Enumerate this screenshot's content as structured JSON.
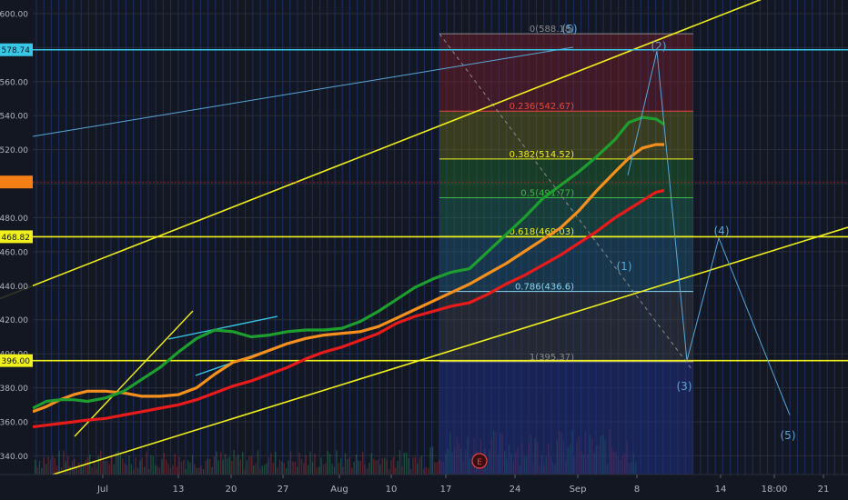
{
  "chart_data": {
    "type": "line",
    "title": "",
    "xlabel": "",
    "ylabel": "",
    "ylim": [
      329,
      608
    ],
    "y_ticks": [
      340,
      360,
      380,
      400,
      420,
      440,
      460,
      480,
      500,
      520,
      540,
      560,
      580,
      600
    ],
    "y_tick_labels": [
      "340.00",
      "360.00",
      "380.00",
      "400.00",
      "420.00",
      "440.00",
      "460.00",
      "480.00",
      "500.00",
      "520.00",
      "540.00",
      "560.00",
      "580.00",
      "600.00"
    ],
    "x_tick_labels": [
      "Jul",
      "13",
      "20",
      "27",
      "Aug",
      "10",
      "17",
      "24",
      "Sep",
      "8",
      "14",
      "18:00",
      "21"
    ],
    "grid": true,
    "background": "#131722",
    "colors": {
      "sma_green": "#1e9e2f",
      "sma_orange": "#f5901e",
      "sma_red": "#e81b1b",
      "trendline": "#f0f01e",
      "cyan_level": "#38c7e6",
      "wave_label": "#5aa7d6",
      "fib_label": "#f0f01e"
    },
    "price_levels": [
      {
        "value": 578.74,
        "label": "578.74",
        "color": "#38c7e6"
      },
      {
        "value": 468.82,
        "label": "468.82",
        "color": "#f0f01e"
      },
      {
        "value": 396.0,
        "label": "396.00",
        "color": "#f0f01e"
      }
    ],
    "current_price_marker": {
      "value": 501,
      "color": "#f57f17"
    },
    "fib_levels": [
      {
        "ratio": "0",
        "value": 588.18,
        "label": "0(588.18)",
        "color": "#8a8a8a"
      },
      {
        "ratio": "0.236",
        "value": 542.67,
        "label": "0.236(542.67)",
        "color": "#e8453c"
      },
      {
        "ratio": "0.382",
        "value": 514.52,
        "label": "0.382(514.52)",
        "color": "#f0f01e"
      },
      {
        "ratio": "0.5",
        "value": 491.77,
        "label": "0.5(491.77)",
        "color": "#3cb84a"
      },
      {
        "ratio": "0.618",
        "value": 469.03,
        "label": "0.618(469.03)",
        "color": "#f0f01e"
      },
      {
        "ratio": "0.786",
        "value": 436.6,
        "label": "0.786(436.6)",
        "color": "#8bd5f0"
      },
      {
        "ratio": "1",
        "value": 395.37,
        "label": "1(395.37)",
        "color": "#8a8a8a"
      }
    ],
    "wave_labels": [
      "(5)",
      "(2)",
      "(1)",
      "(3)",
      "(4)",
      "(5)"
    ],
    "event_marker": "E",
    "series": [
      {
        "x": [
          0,
          15,
          30,
          45,
          60,
          80,
          100,
          120,
          140,
          160,
          180,
          200,
          220,
          240,
          260,
          280,
          300,
          320,
          340,
          360,
          380,
          400,
          420,
          440,
          460,
          480,
          500,
          520,
          540,
          560,
          580,
          600,
          620,
          640,
          655,
          670,
          685,
          694
        ],
        "values": [
          366,
          369,
          373,
          376,
          378,
          378,
          377,
          375,
          375,
          376,
          380,
          388,
          395,
          398,
          402,
          406,
          409,
          411,
          412,
          413,
          416,
          421,
          426,
          431,
          436,
          441,
          447,
          453,
          460,
          467,
          474,
          484,
          496,
          507,
          515,
          521,
          523,
          523
        ]
      },
      {
        "x": [
          0,
          15,
          30,
          45,
          60,
          80,
          100,
          120,
          140,
          160,
          180,
          200,
          220,
          240,
          260,
          280,
          300,
          320,
          340,
          360,
          380,
          400,
          420,
          440,
          460,
          480,
          500,
          520,
          540,
          560,
          580,
          600,
          620,
          640,
          655,
          670,
          685,
          694
        ],
        "values": [
          357,
          358,
          359,
          360,
          361,
          362,
          364,
          366,
          368,
          370,
          373,
          377,
          381,
          384,
          388,
          392,
          397,
          401,
          404,
          408,
          412,
          418,
          422,
          425,
          428,
          430,
          435,
          441,
          446,
          452,
          458,
          465,
          472,
          480,
          485,
          490,
          495,
          496
        ]
      },
      {
        "x": [
          0,
          15,
          30,
          45,
          60,
          80,
          100,
          120,
          140,
          160,
          180,
          200,
          220,
          240,
          260,
          280,
          300,
          320,
          340,
          360,
          380,
          400,
          420,
          440,
          460,
          480,
          500,
          520,
          540,
          560,
          580,
          600,
          620,
          640,
          655,
          670,
          685,
          694
        ],
        "values": [
          368,
          372,
          373,
          373,
          372,
          374,
          378,
          385,
          392,
          401,
          409,
          414,
          413,
          410,
          411,
          413,
          414,
          414,
          415,
          419,
          425,
          432,
          439,
          444,
          448,
          450,
          460,
          470,
          480,
          491,
          499,
          507,
          516,
          526,
          536,
          539,
          538,
          535
        ]
      }
    ]
  }
}
